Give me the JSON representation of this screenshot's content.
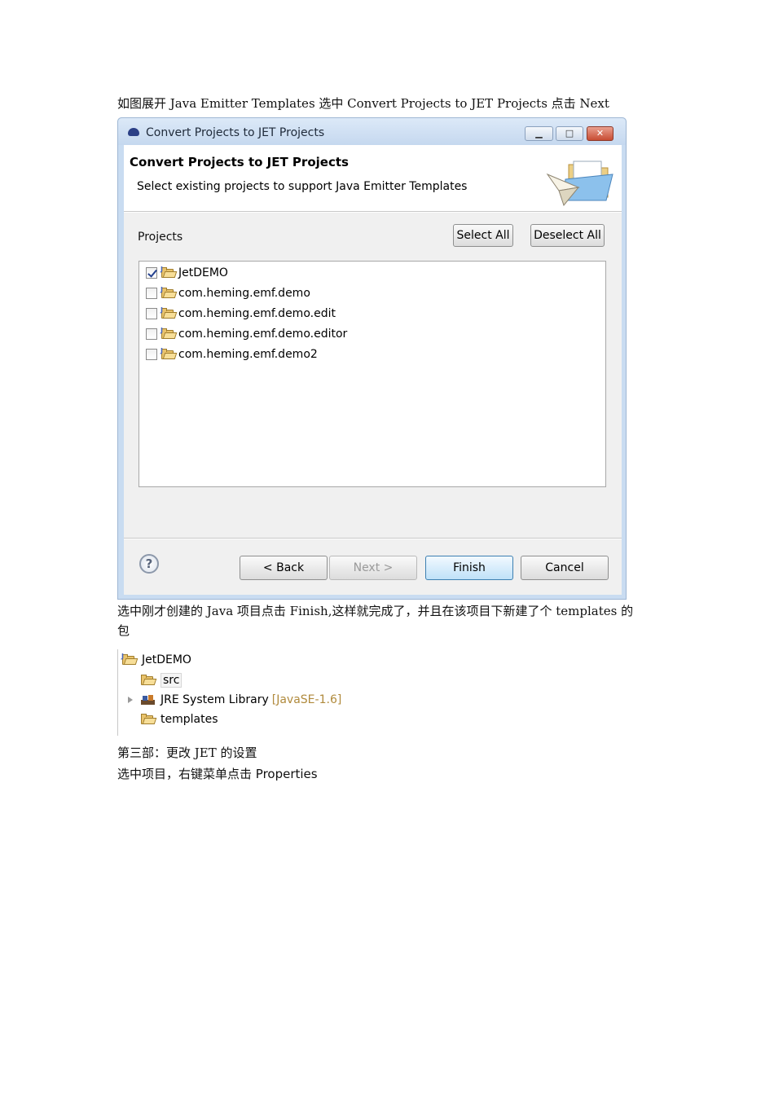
{
  "text": {
    "intro": "如图展开 Java Emitter Templates 选中 Convert Projects to JET Projects 点击 Next",
    "after_line1": "选中刚才创建的 Java 项目点击 Finish,这样就完成了，并且在该项目下新建了个 templates 的",
    "after_line2": "包",
    "step3": "第三部：更改 JET 的设置",
    "step3_desc_prefix": "选中项目，右键菜单点击 ",
    "step3_desc_word": "Properties"
  },
  "dialog": {
    "window_title": "Convert Projects to JET Projects",
    "heading": "Convert Projects to JET Projects",
    "description": "Select existing projects to support Java Emitter Templates",
    "projects_label": "Projects",
    "select_all": "Select All",
    "deselect_all": "Deselect All",
    "projects": [
      {
        "name": "JetDEMO",
        "checked": true
      },
      {
        "name": "com.heming.emf.demo",
        "checked": false
      },
      {
        "name": "com.heming.emf.demo.edit",
        "checked": false
      },
      {
        "name": "com.heming.emf.demo.editor",
        "checked": false
      },
      {
        "name": "com.heming.emf.demo2",
        "checked": false
      }
    ],
    "help_glyph": "?",
    "back": "< Back",
    "next": "Next >",
    "finish": "Finish",
    "cancel": "Cancel",
    "icons": {
      "title": "eclipse-icon",
      "banner": "folder-paper-plane-icon",
      "project": "java-project-folder-icon"
    }
  },
  "tree": {
    "project": "JetDEMO",
    "src": "src",
    "jre": "JRE System Library",
    "jre_version": "[JavaSE-1.6]",
    "templates": "templates"
  },
  "colors": {
    "window_frame": "#c9dcf1",
    "finish_border": "#3c7fb1",
    "jre_version": "#b08a3c"
  }
}
